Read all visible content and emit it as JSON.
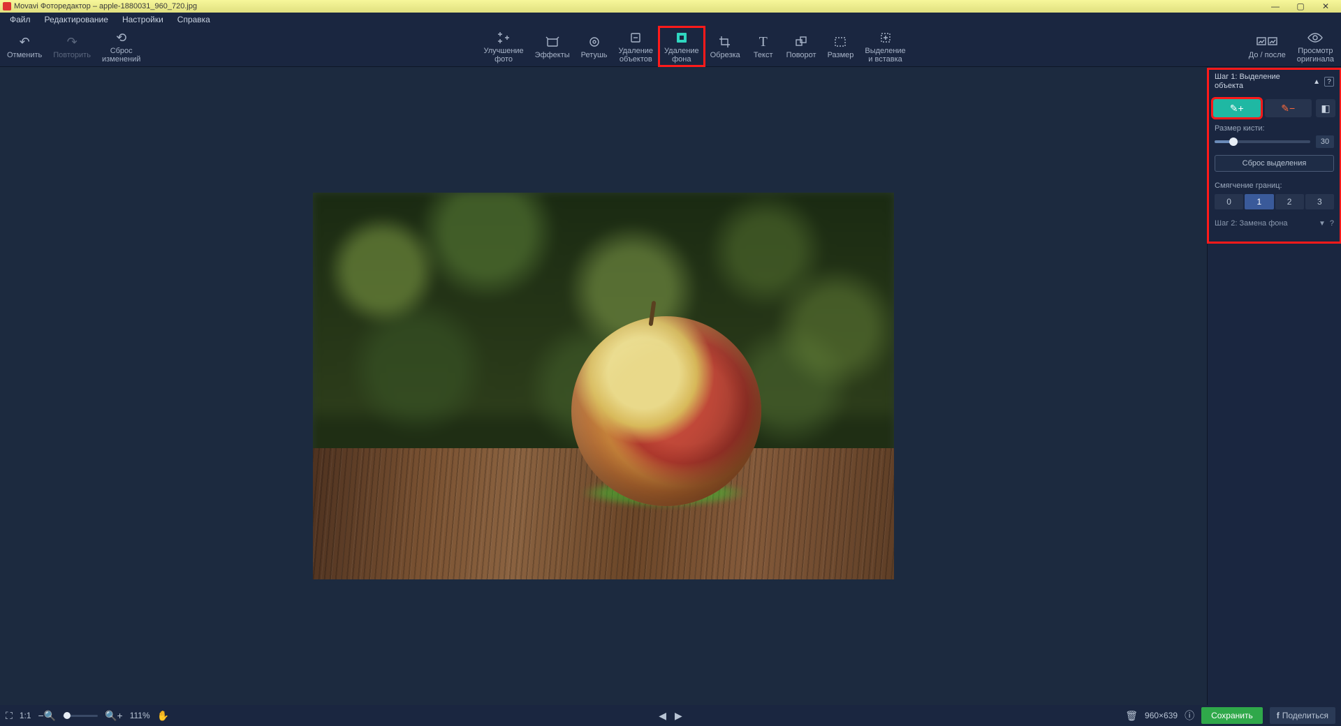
{
  "titlebar": {
    "app_title": "Movavi Фоторедактор – apple-1880031_960_720.jpg"
  },
  "menu": {
    "file": "Файл",
    "edit": "Редактирование",
    "settings": "Настройки",
    "help": "Справка"
  },
  "toolbar": {
    "undo": "Отменить",
    "redo": "Повторить",
    "reset_changes": "Сброс\nизменений",
    "enhance": "Улучшение\nфото",
    "effects": "Эффекты",
    "retouch": "Ретушь",
    "remove_objects": "Удаление\nобъектов",
    "remove_bg": "Удаление\nфона",
    "crop": "Обрезка",
    "text": "Текст",
    "rotate": "Поворот",
    "resize": "Размер",
    "select_insert": "Выделение\nи вставка",
    "before_after": "До / после",
    "view_original": "Просмотр\nоригинала"
  },
  "panel": {
    "step1": "Шаг 1: Выделение объекта",
    "brush_size_label": "Размер кисти:",
    "brush_size_value": "30",
    "reset_selection": "Сброс выделения",
    "edge_soften_label": "Смягчение границ:",
    "seg0": "0",
    "seg1": "1",
    "seg2": "2",
    "seg3": "3",
    "step2": "Шаг 2: Замена фона",
    "help": "?"
  },
  "status": {
    "fit": "1:1",
    "zoom_pct": "111%",
    "dims": "960×639",
    "save": "Сохранить",
    "share": "Поделиться",
    "info_icon": "ⓘ"
  }
}
